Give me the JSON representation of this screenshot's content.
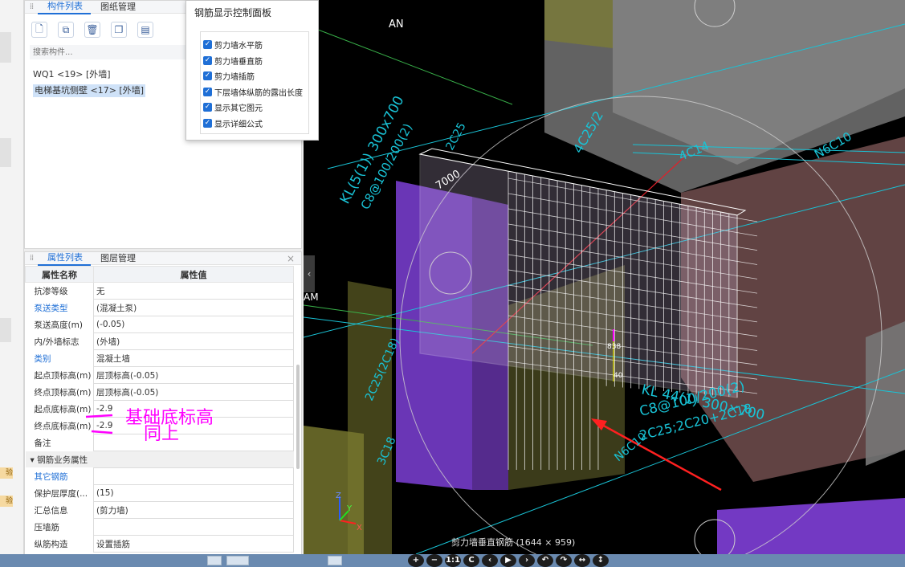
{
  "component_panel": {
    "tabs": [
      {
        "label": "构件列表"
      },
      {
        "label": "图纸管理"
      }
    ],
    "search_placeholder": "搜索构件...",
    "items": [
      {
        "label": "WQ1 <19> [外墙]"
      },
      {
        "label": "电梯基坑侧壁 <17> [外墙]"
      }
    ]
  },
  "property_panel": {
    "tabs": [
      {
        "label": "属性列表"
      },
      {
        "label": "图层管理"
      }
    ],
    "headers": {
      "name": "属性名称",
      "value": "属性值"
    },
    "rows": [
      {
        "name": "抗渗等级",
        "value": "无"
      },
      {
        "name": "泵送类型",
        "value": "(混凝土泵)"
      },
      {
        "name": "泵送高度(m)",
        "value": "(-0.05)"
      },
      {
        "name": "内/外墙标志",
        "value": "(外墙)"
      },
      {
        "name": "类别",
        "value": "混凝土墙"
      },
      {
        "name": "起点顶标高(m)",
        "value": "层顶标高(-0.05)"
      },
      {
        "name": "终点顶标高(m)",
        "value": "层顶标高(-0.05)"
      },
      {
        "name": "起点底标高(m)",
        "value": "-2.9"
      },
      {
        "name": "终点底标高(m)",
        "value": "-2.9"
      },
      {
        "name": "备注",
        "value": ""
      }
    ],
    "section_title": "钢筋业务属性",
    "rows2": [
      {
        "name": "其它钢筋",
        "value": ""
      },
      {
        "name": "保护层厚度(...",
        "value": "(15)"
      },
      {
        "name": "汇总信息",
        "value": "(剪力墙)"
      },
      {
        "name": "压墙筋",
        "value": ""
      },
      {
        "name": "纵筋构造",
        "value": "设置插筋"
      }
    ]
  },
  "annotations": {
    "line1": "基础底标高",
    "line2": "同上"
  },
  "control_panel": {
    "title": "钢筋显示控制面板",
    "options": [
      {
        "label": "剪力墙水平筋",
        "checked": true
      },
      {
        "label": "剪力墙垂直筋",
        "checked": true
      },
      {
        "label": "剪力墙插筋",
        "checked": true
      },
      {
        "label": "下层墙体纵筋的露出长度",
        "checked": true
      },
      {
        "label": "显示其它图元",
        "checked": true
      },
      {
        "label": "显示详细公式",
        "checked": true
      }
    ]
  },
  "viewport": {
    "axis_labels": {
      "an": "AN",
      "am": "AM"
    },
    "beam_labels": {
      "kl_left": "KL(5(1)) 300x700",
      "kl_left2": "C8@100/200(2)",
      "kl_left3": "2C25",
      "top_4c": "4C25/2",
      "top_4c14": "4C14",
      "top_right": "N6C10",
      "dim_7000": "7000",
      "kl_bottom": "KL 44(1) 300×700",
      "kl_bottom2": "C8@100/200(2)",
      "kl_bottom3": "2C25;2C20+2C18",
      "n6c10": "N6C10",
      "left_2c": "2C25(2C18)",
      "left_3c": "3C18",
      "ruler_top": "838",
      "ruler_bottom": "40"
    },
    "caption": "剪力墙垂直钢筋 (1644 × 959)",
    "gizmo": {
      "x": "X",
      "y": "Y",
      "z": "Z"
    }
  },
  "nav_buttons": [
    {
      "icon": "+"
    },
    {
      "icon": "−"
    },
    {
      "icon": "1:1"
    },
    {
      "icon": "C"
    },
    {
      "icon": "‹"
    },
    {
      "icon": "▶"
    },
    {
      "icon": "›"
    },
    {
      "icon": "↶"
    },
    {
      "icon": "↷"
    },
    {
      "icon": "↔"
    },
    {
      "icon": "↕"
    }
  ],
  "colors": {
    "accent": "#1f6fd6",
    "annotation": "#ff00ff",
    "viewport_bg": "#000000"
  }
}
